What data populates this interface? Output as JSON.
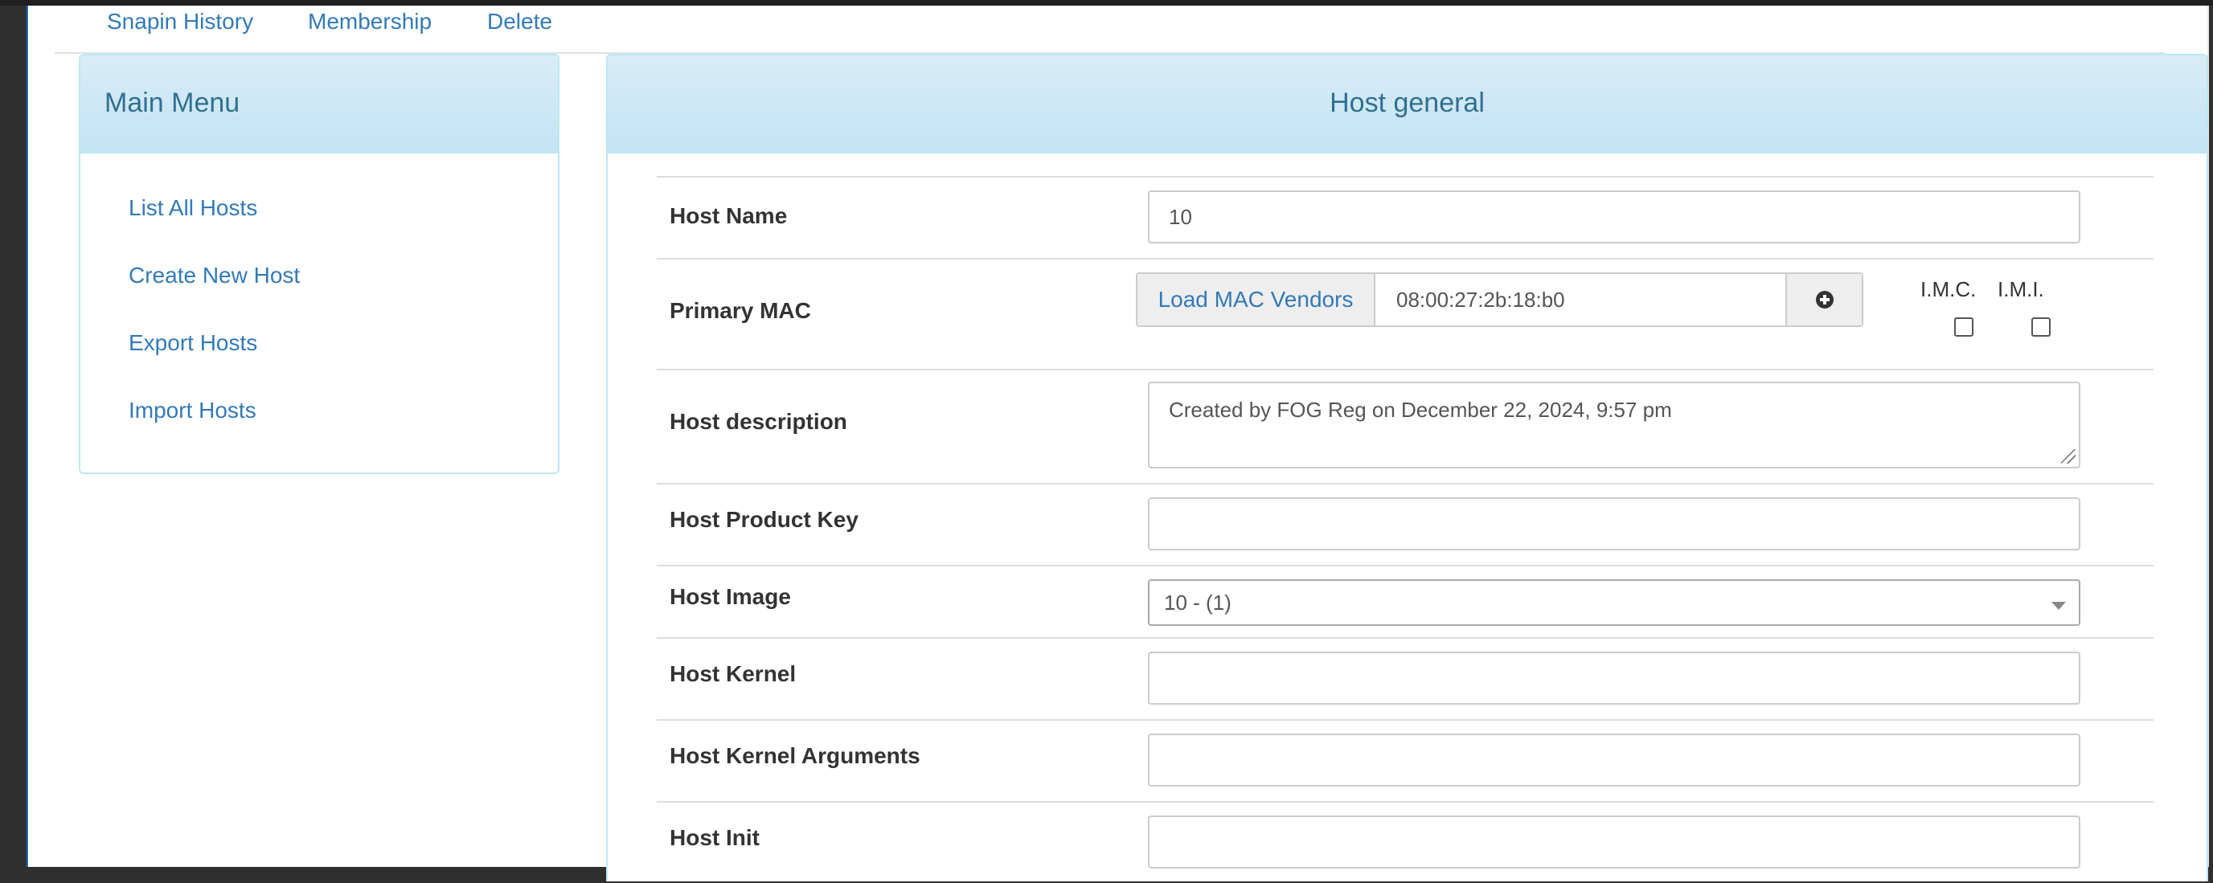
{
  "subnav": {
    "items": [
      "Snapin History",
      "Membership",
      "Delete"
    ]
  },
  "menu": {
    "title": "Main Menu",
    "items": [
      "List All Hosts",
      "Create New Host",
      "Export Hosts",
      "Import Hosts"
    ]
  },
  "host_general": {
    "title": "Host general",
    "host_name": {
      "label": "Host Name",
      "value": "10"
    },
    "primary_mac": {
      "label": "Primary MAC",
      "load_vendors_label": "Load MAC Vendors",
      "value": "08:00:27:2b:18:b0",
      "imc_label": "I.M.C.",
      "imi_label": "I.M.I.",
      "imc_checked": false,
      "imi_checked": false
    },
    "description": {
      "label": "Host description",
      "value": "Created by FOG Reg on December 22, 2024, 9:57 pm"
    },
    "product_key": {
      "label": "Host Product Key",
      "value": ""
    },
    "image": {
      "label": "Host Image",
      "selected": "10 - (1)"
    },
    "kernel": {
      "label": "Host Kernel",
      "value": ""
    },
    "kernel_args": {
      "label": "Host Kernel Arguments",
      "value": ""
    },
    "init": {
      "label": "Host Init",
      "value": ""
    }
  },
  "colors": {
    "link": "#337ab7",
    "panel_heading": "#d9edf7",
    "panel_border": "#bce8f1",
    "panel_title": "#31708f"
  },
  "icons": {
    "add_mac": "plus-circle-icon",
    "select": "caret-down-icon"
  }
}
